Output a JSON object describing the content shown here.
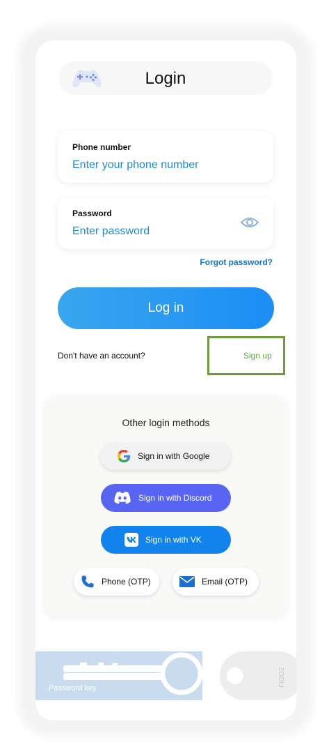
{
  "header": {
    "title": "Login",
    "logo_icon": "gamepad-icon"
  },
  "phone_field": {
    "label": "Phone number",
    "placeholder": "Enter your phone number",
    "value": ""
  },
  "password_field": {
    "label": "Password",
    "placeholder": "Enter password",
    "value": "",
    "toggle_icon": "eye-icon"
  },
  "forgot_password": "Forgot password?",
  "login_button": "Log in",
  "signup_prompt": {
    "text": "Don't have an account?",
    "link": "Sign up"
  },
  "other_methods": {
    "title": "Other login methods",
    "buttons": [
      {
        "label": "Sign in with Google",
        "icon": "google-icon"
      },
      {
        "label": "Sign in with Discord",
        "icon": "discord-icon"
      },
      {
        "label": "Sign in with VK",
        "icon": "vk-icon"
      },
      {
        "label": "Phone (OTP)",
        "icon": "phone-icon"
      },
      {
        "label": "Email (OTP)",
        "icon": "mail-icon"
      }
    ]
  },
  "auth_cards": {
    "password_key": "Password key",
    "fido": "FIDO2"
  },
  "colors": {
    "accent": "#1b8df5",
    "link": "#1673c8",
    "signup": "#5aa83d",
    "discord": "#5865f2",
    "vk": "#1282ec"
  }
}
